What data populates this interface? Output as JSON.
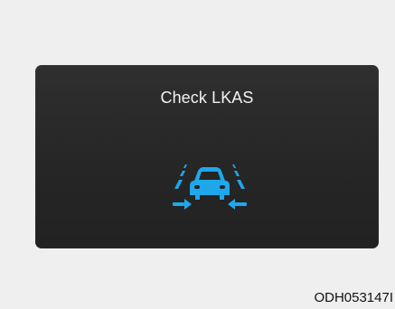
{
  "panel": {
    "title": "Check LKAS",
    "icon_name": "lane-keeping-assist-icon",
    "icon_color": "#1ea8ea",
    "background_color": "#2b2b2b",
    "title_color": "#f2f2f2"
  },
  "footer": {
    "code": "ODH053147I"
  },
  "page": {
    "background_color": "#efefef"
  }
}
